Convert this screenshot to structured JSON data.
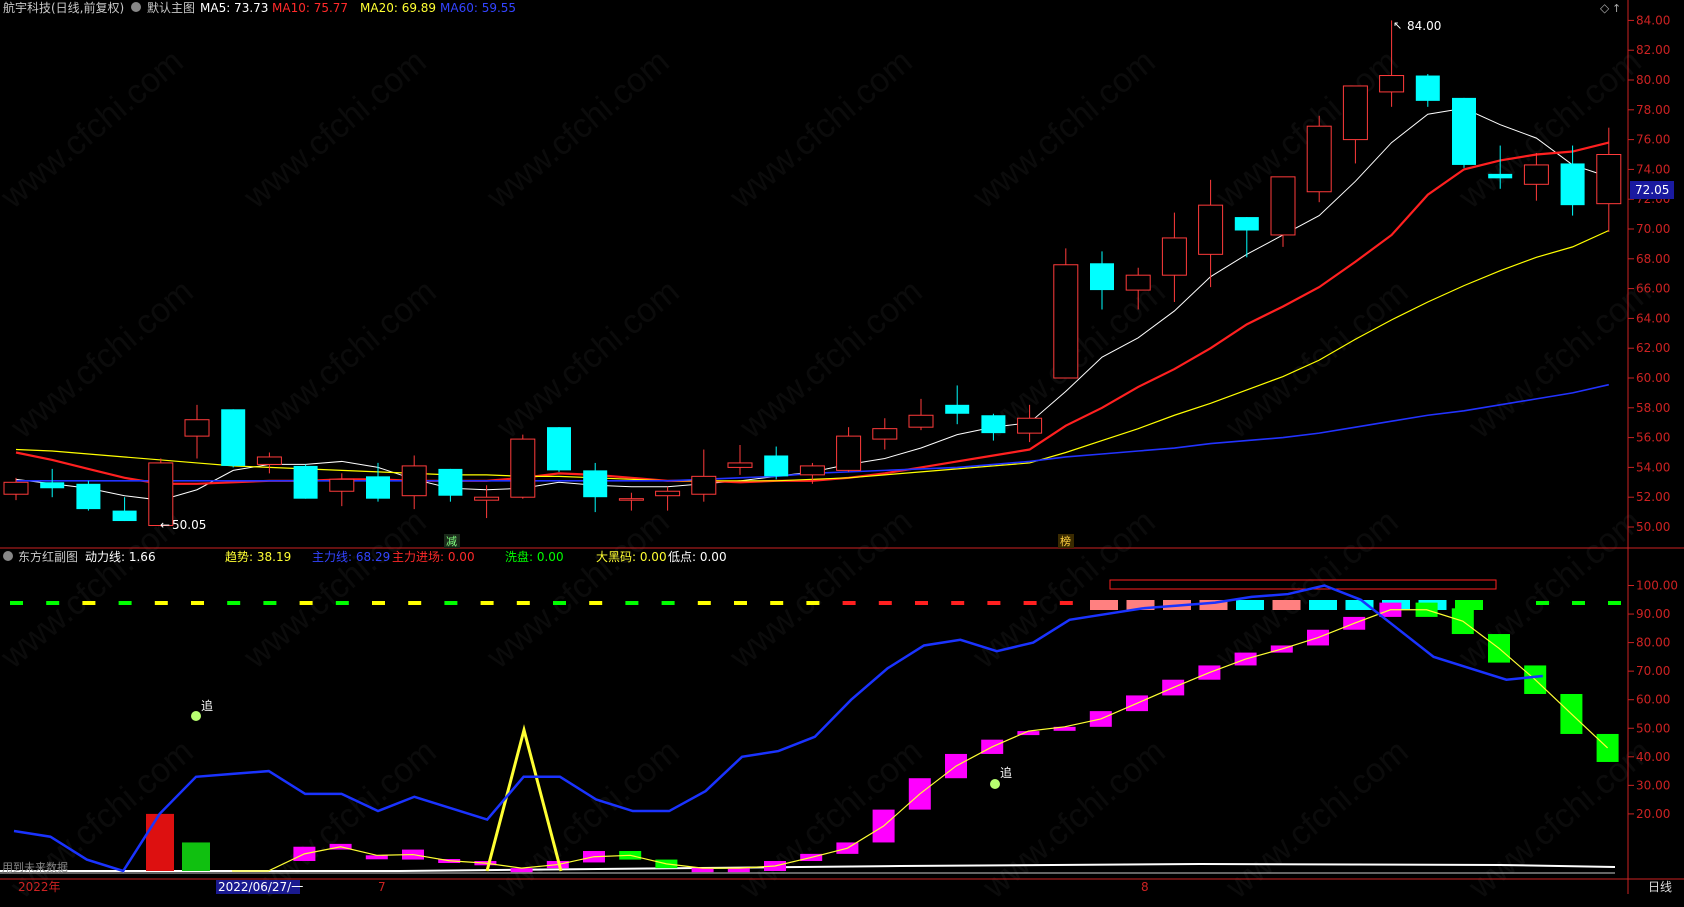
{
  "header": {
    "stock_name": "航宇科技(日线,前复权)",
    "chart_name": "默认主图",
    "ma5_label": "MA5: 73.73",
    "ma10_label": "MA10: 75.77",
    "ma20_label": "MA20: 69.89",
    "ma60_label": "MA60: 59.55"
  },
  "sub_header": {
    "name": "东方红副图",
    "power_line": "动力线: 1.66",
    "trend": "趋势: 38.19",
    "main_line": "主力线: 68.29",
    "main_entry": "主力进场: 0.00",
    "wash": "洗盘: 0.00",
    "dark_horse": "大黑码: 0.00",
    "low_point": "低点: 0.00"
  },
  "annotations": {
    "high_label": "84.00",
    "low_label": "50.05",
    "current_price": "72.05",
    "reduce_tag": "减",
    "surge_tag": "榜",
    "chase_1": "追",
    "chase_2": "追"
  },
  "bottom_bar": {
    "year_label": "2022年",
    "date_label": "2022/06/27/一",
    "month_7": "7",
    "month_8": "8",
    "period": "日线",
    "footer_text": "用到未来数据"
  },
  "watermark": "www.cfchi.com",
  "colors": {
    "up": "#ff3b3b",
    "down": "#00ffff",
    "ma5": "#ffffff",
    "ma10": "#ff2020",
    "ma20": "#ffff00",
    "ma60": "#2233ff",
    "axis": "#cc2222",
    "magenta": "#ff00ff",
    "green": "#00ff00"
  },
  "chart_data": [
    {
      "type": "candlestick",
      "title": "默认主图",
      "y_ticks": [
        50.0,
        52.0,
        54.0,
        56.0,
        58.0,
        60.0,
        62.0,
        64.0,
        66.0,
        68.0,
        70.0,
        72.0,
        74.0,
        76.0,
        78.0,
        80.0,
        82.0,
        84.0
      ],
      "ylim": [
        49.0,
        85.0
      ],
      "candles": [
        {
          "o": 52.2,
          "h": 53.3,
          "l": 51.8,
          "c": 53.0
        },
        {
          "o": 53.0,
          "h": 53.9,
          "l": 52.0,
          "c": 52.6
        },
        {
          "o": 52.9,
          "h": 53.1,
          "l": 51.1,
          "c": 51.2
        },
        {
          "o": 51.1,
          "h": 52.0,
          "l": 50.4,
          "c": 50.4
        },
        {
          "o": 50.1,
          "h": 54.6,
          "l": 50.05,
          "c": 54.3
        },
        {
          "o": 56.1,
          "h": 58.2,
          "l": 54.6,
          "c": 57.2
        },
        {
          "o": 57.9,
          "h": 57.9,
          "l": 54.0,
          "c": 54.1
        },
        {
          "o": 54.2,
          "h": 55.0,
          "l": 53.6,
          "c": 54.7
        },
        {
          "o": 54.1,
          "h": 54.2,
          "l": 51.9,
          "c": 51.9
        },
        {
          "o": 52.4,
          "h": 53.6,
          "l": 51.4,
          "c": 53.2
        },
        {
          "o": 53.4,
          "h": 54.3,
          "l": 51.7,
          "c": 51.9
        },
        {
          "o": 52.1,
          "h": 54.8,
          "l": 51.2,
          "c": 54.1
        },
        {
          "o": 53.9,
          "h": 53.9,
          "l": 51.7,
          "c": 52.1
        },
        {
          "o": 51.8,
          "h": 52.8,
          "l": 50.6,
          "c": 52.0
        },
        {
          "o": 52.0,
          "h": 56.2,
          "l": 51.9,
          "c": 55.9
        },
        {
          "o": 56.7,
          "h": 56.7,
          "l": 53.7,
          "c": 53.8
        },
        {
          "o": 53.8,
          "h": 54.3,
          "l": 51.0,
          "c": 52.0
        },
        {
          "o": 51.8,
          "h": 52.3,
          "l": 51.1,
          "c": 51.9
        },
        {
          "o": 52.1,
          "h": 52.7,
          "l": 51.1,
          "c": 52.4
        },
        {
          "o": 52.2,
          "h": 55.2,
          "l": 51.7,
          "c": 53.4
        },
        {
          "o": 54.0,
          "h": 55.5,
          "l": 53.5,
          "c": 54.3
        },
        {
          "o": 54.8,
          "h": 55.4,
          "l": 53.2,
          "c": 53.4
        },
        {
          "o": 53.5,
          "h": 54.3,
          "l": 52.9,
          "c": 54.1
        },
        {
          "o": 53.8,
          "h": 56.7,
          "l": 53.7,
          "c": 56.1
        },
        {
          "o": 55.9,
          "h": 57.3,
          "l": 55.2,
          "c": 56.6
        },
        {
          "o": 56.7,
          "h": 58.6,
          "l": 56.5,
          "c": 57.5
        },
        {
          "o": 58.2,
          "h": 59.5,
          "l": 56.9,
          "c": 57.6
        },
        {
          "o": 57.5,
          "h": 57.6,
          "l": 55.8,
          "c": 56.3
        },
        {
          "o": 56.3,
          "h": 58.2,
          "l": 55.7,
          "c": 57.3
        },
        {
          "o": 60.0,
          "h": 68.7,
          "l": 60.0,
          "c": 67.6
        },
        {
          "o": 67.7,
          "h": 68.5,
          "l": 64.6,
          "c": 65.9
        },
        {
          "o": 65.9,
          "h": 67.4,
          "l": 64.6,
          "c": 66.9
        },
        {
          "o": 66.9,
          "h": 71.1,
          "l": 65.1,
          "c": 69.4
        },
        {
          "o": 68.3,
          "h": 73.3,
          "l": 66.1,
          "c": 71.6
        },
        {
          "o": 70.8,
          "h": 70.8,
          "l": 68.1,
          "c": 69.9
        },
        {
          "o": 69.6,
          "h": 73.4,
          "l": 68.8,
          "c": 73.5
        },
        {
          "o": 72.5,
          "h": 77.6,
          "l": 71.8,
          "c": 76.9
        },
        {
          "o": 76.0,
          "h": 79.6,
          "l": 74.4,
          "c": 79.6
        },
        {
          "o": 79.2,
          "h": 84.0,
          "l": 78.2,
          "c": 80.3
        },
        {
          "o": 80.3,
          "h": 80.4,
          "l": 78.2,
          "c": 78.6
        },
        {
          "o": 78.8,
          "h": 78.8,
          "l": 74.1,
          "c": 74.3
        },
        {
          "o": 73.7,
          "h": 75.6,
          "l": 72.7,
          "c": 73.4
        },
        {
          "o": 73.0,
          "h": 75.1,
          "l": 71.9,
          "c": 74.3
        },
        {
          "o": 74.4,
          "h": 75.6,
          "l": 70.9,
          "c": 71.6
        },
        {
          "o": 71.7,
          "h": 76.8,
          "l": 69.8,
          "c": 75.0
        }
      ],
      "series": [
        {
          "name": "MA5",
          "values": [
            53.2,
            52.9,
            52.6,
            52.1,
            51.8,
            52.5,
            53.8,
            54.2,
            54.2,
            54.4,
            54.0,
            53.2,
            52.6,
            52.5,
            52.6,
            53.0,
            52.8,
            52.7,
            52.7,
            52.9,
            53.1,
            53.4,
            53.7,
            54.2,
            54.6,
            55.3,
            56.2,
            56.7,
            57.0,
            59.1,
            61.4,
            62.7,
            64.5,
            66.8,
            68.3,
            69.6,
            70.9,
            73.2,
            75.8,
            77.7,
            78.1,
            77.0,
            76.1,
            74.3,
            73.5
          ]
        },
        {
          "name": "MA10",
          "values": [
            55.0,
            54.5,
            53.9,
            53.3,
            52.9,
            52.9,
            53.0,
            53.1,
            53.1,
            53.2,
            53.2,
            53.1,
            53.1,
            53.1,
            53.3,
            53.6,
            53.5,
            53.3,
            53.1,
            53.1,
            53.0,
            53.1,
            53.1,
            53.3,
            53.6,
            54.0,
            54.4,
            54.8,
            55.2,
            56.8,
            58.0,
            59.4,
            60.6,
            62.0,
            63.6,
            64.8,
            66.1,
            67.8,
            69.6,
            72.3,
            74.0,
            74.6,
            75.0,
            75.2,
            75.8
          ]
        },
        {
          "name": "MA20",
          "values": [
            55.2,
            55.1,
            54.9,
            54.7,
            54.5,
            54.3,
            54.1,
            54.0,
            53.9,
            53.8,
            53.7,
            53.6,
            53.5,
            53.5,
            53.4,
            53.4,
            53.3,
            53.2,
            53.1,
            53.1,
            53.1,
            53.1,
            53.2,
            53.3,
            53.5,
            53.7,
            53.9,
            54.1,
            54.3,
            55.0,
            55.8,
            56.6,
            57.5,
            58.3,
            59.2,
            60.1,
            61.2,
            62.6,
            63.9,
            65.1,
            66.2,
            67.2,
            68.1,
            68.8,
            69.9
          ]
        },
        {
          "name": "MA60",
          "values": [
            53.1,
            53.1,
            53.1,
            53.1,
            53.1,
            53.1,
            53.1,
            53.1,
            53.1,
            53.1,
            53.1,
            53.1,
            53.1,
            53.1,
            53.1,
            53.1,
            53.1,
            53.1,
            53.1,
            53.2,
            53.3,
            53.4,
            53.6,
            53.7,
            53.8,
            53.9,
            54.0,
            54.2,
            54.4,
            54.7,
            54.9,
            55.1,
            55.3,
            55.6,
            55.8,
            56.0,
            56.3,
            56.7,
            57.1,
            57.5,
            57.8,
            58.2,
            58.6,
            59.0,
            59.55
          ]
        }
      ]
    },
    {
      "type": "bar",
      "title": "东方红副图",
      "y_ticks": [
        20.0,
        30.0,
        40.0,
        50.0,
        60.0,
        70.0,
        80.0,
        90.0,
        100.0
      ],
      "ylim": [
        0,
        100
      ],
      "main_line": [
        14,
        12,
        4,
        0,
        20,
        33,
        34,
        35,
        27,
        27,
        21,
        26,
        22,
        18,
        33,
        33,
        25,
        21,
        21,
        28,
        40,
        42,
        47,
        60,
        71,
        79,
        81,
        77,
        80,
        88,
        90,
        92,
        93,
        94,
        96,
        97,
        100,
        95,
        85,
        75,
        71,
        67,
        68.29
      ],
      "trend_bars": [
        {
          "o": 0,
          "c": 0
        },
        {
          "o": 0,
          "c": 0
        },
        {
          "o": 0,
          "c": 0
        },
        {
          "o": 0,
          "c": 0
        },
        {
          "o": 0,
          "c": 0
        },
        {
          "o": 0,
          "c": 0
        },
        {
          "o": 0,
          "c": 0
        },
        {
          "o": 3.5,
          "c": 8.5
        },
        {
          "o": 7.5,
          "c": 9.5
        },
        {
          "o": 5.5,
          "c": 5.5
        },
        {
          "o": 4,
          "c": 7.5
        },
        {
          "o": 3,
          "c": 4.2
        },
        {
          "o": 2,
          "c": 3.5
        },
        {
          "o": 1,
          "c": 1
        },
        {
          "o": 1,
          "c": 3.5
        },
        {
          "o": 3,
          "c": 7
        },
        {
          "o": 7,
          "c": 4
        },
        {
          "o": 4,
          "c": 1
        },
        {
          "o": 1,
          "c": 1
        },
        {
          "o": 1,
          "c": 1
        },
        {
          "o": 0,
          "c": 3.5
        },
        {
          "o": 3.5,
          "c": 6
        },
        {
          "o": 6,
          "c": 10
        },
        {
          "o": 10,
          "c": 21.5
        },
        {
          "o": 21.5,
          "c": 32.5
        },
        {
          "o": 32.5,
          "c": 41
        },
        {
          "o": 41,
          "c": 46
        },
        {
          "o": 49,
          "c": 49
        },
        {
          "o": 50.5,
          "c": 50.5
        },
        {
          "o": 50.5,
          "c": 56
        },
        {
          "o": 56,
          "c": 61.5
        },
        {
          "o": 61.5,
          "c": 67
        },
        {
          "o": 67,
          "c": 72
        },
        {
          "o": 72,
          "c": 76.5
        },
        {
          "o": 76.5,
          "c": 79
        },
        {
          "o": 79,
          "c": 84.5
        },
        {
          "o": 84.5,
          "c": 89
        },
        {
          "o": 89,
          "c": 94
        },
        {
          "o": 94,
          "c": 89
        },
        {
          "o": 92,
          "c": 83
        },
        {
          "o": 83,
          "c": 73
        },
        {
          "o": 72,
          "c": 62
        },
        {
          "o": 62,
          "c": 48
        },
        {
          "o": 48,
          "c": 38.19
        }
      ],
      "signal_spike": {
        "x_index": 14,
        "value": 50
      },
      "main_entry_bars": [
        {
          "x_index": 4,
          "value": 20
        },
        {
          "x_index": 5,
          "value": 10
        }
      ]
    }
  ]
}
